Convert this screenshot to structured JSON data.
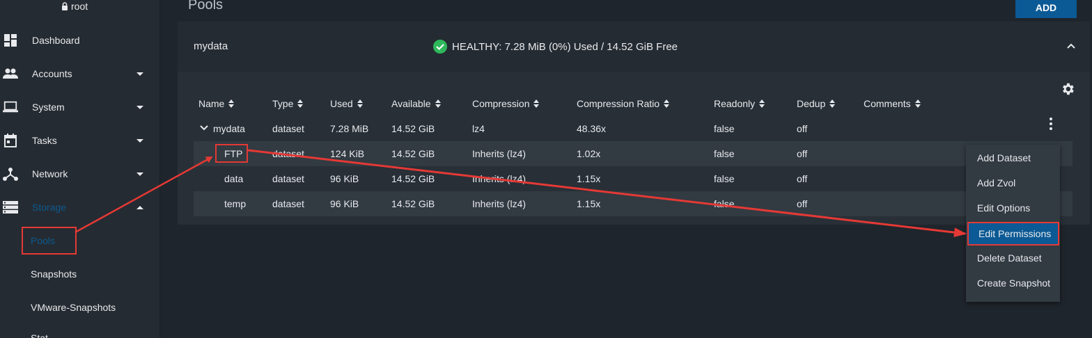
{
  "user": {
    "name": "root",
    "icon": "lock-icon"
  },
  "sidebar": {
    "items": [
      {
        "label": "Dashboard",
        "icon": "dashboard-icon",
        "expandable": false
      },
      {
        "label": "Accounts",
        "icon": "people-icon",
        "expandable": true
      },
      {
        "label": "System",
        "icon": "laptop-icon",
        "expandable": true
      },
      {
        "label": "Tasks",
        "icon": "calendar-icon",
        "expandable": true
      },
      {
        "label": "Network",
        "icon": "network-icon",
        "expandable": true
      },
      {
        "label": "Storage",
        "icon": "storage-icon",
        "expandable": true,
        "expanded": true
      }
    ],
    "sub_items": [
      "Pools",
      "Snapshots",
      "VMware-Snapshots"
    ],
    "active_sub": "Pools"
  },
  "header": {
    "title": "Pools",
    "add_label": "ADD"
  },
  "pool": {
    "name": "mydata",
    "status": "HEALTHY: 7.28 MiB (0%) Used / 14.52 GiB Free"
  },
  "table": {
    "columns": [
      "Name",
      "Type",
      "Used",
      "Available",
      "Compression",
      "Compression Ratio",
      "Readonly",
      "Dedup",
      "Comments"
    ],
    "rows": [
      {
        "name": "mydata",
        "type": "dataset",
        "used": "7.28 MiB",
        "available": "14.52 GiB",
        "compression": "lz4",
        "ratio": "48.36x",
        "readonly": "false",
        "dedup": "off"
      },
      {
        "name": "FTP",
        "type": "dataset",
        "used": "124 KiB",
        "available": "14.52 GiB",
        "compression": "Inherits (lz4)",
        "ratio": "1.02x",
        "readonly": "false",
        "dedup": "off"
      },
      {
        "name": "data",
        "type": "dataset",
        "used": "96 KiB",
        "available": "14.52 GiB",
        "compression": "Inherits (lz4)",
        "ratio": "1.15x",
        "readonly": "false",
        "dedup": "off"
      },
      {
        "name": "temp",
        "type": "dataset",
        "used": "96 KiB",
        "available": "14.52 GiB",
        "compression": "Inherits (lz4)",
        "ratio": "1.15x",
        "readonly": "false",
        "dedup": "off"
      }
    ]
  },
  "menu": {
    "items": [
      "Add Dataset",
      "Add Zvol",
      "Edit Options",
      "Edit Permissions",
      "Delete Dataset",
      "Create Snapshot"
    ],
    "highlighted": "Edit Permissions"
  },
  "colors": {
    "accent": "#0b5a95",
    "annotation": "#e53935",
    "healthy": "#2eb85c"
  }
}
